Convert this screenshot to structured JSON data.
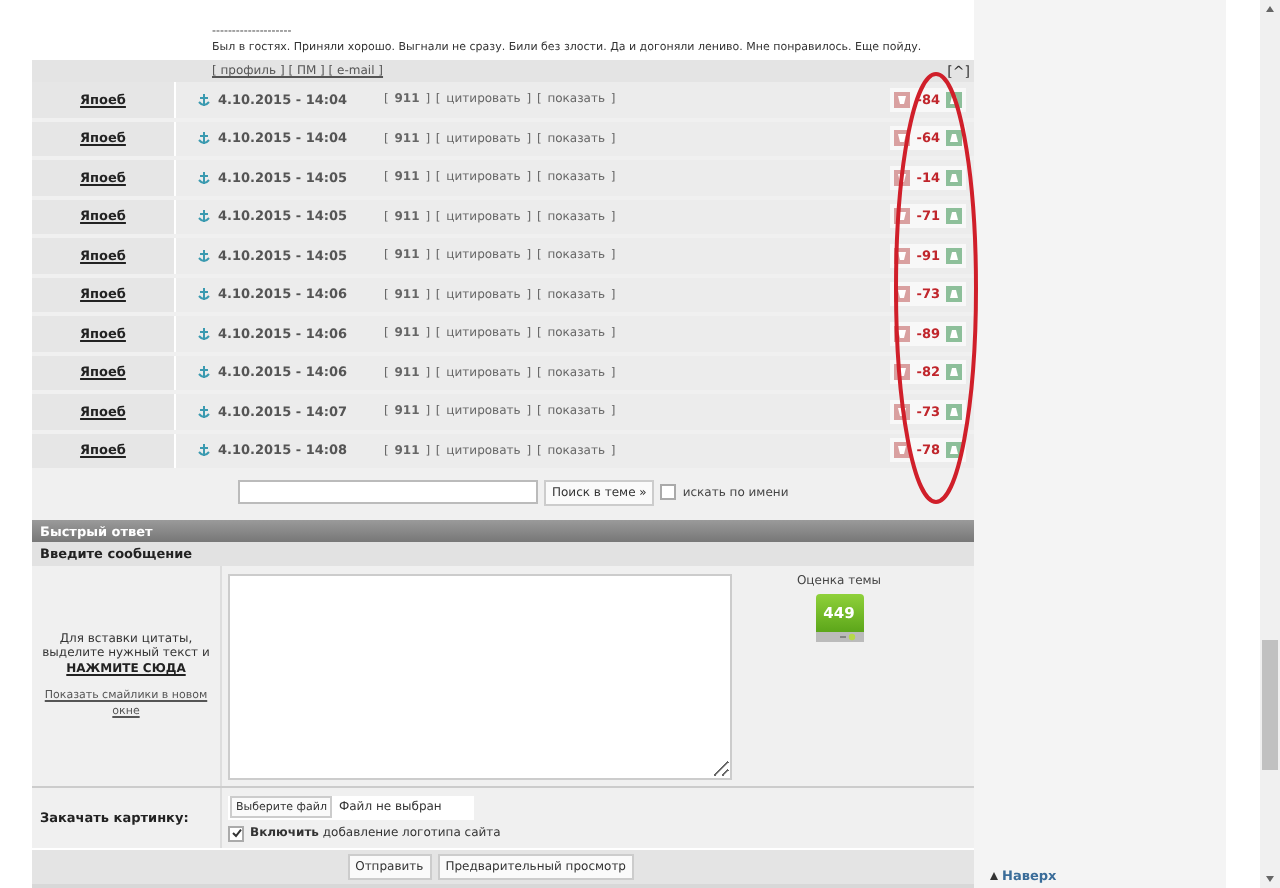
{
  "post": {
    "separator": "--------------------",
    "signature": "Был в гостях. Приняли хорошо. Выгнали не сразу. Били без злости. Да и догоняли лениво. Мне понравилось. Еще пойду.",
    "links": [
      "[ профиль ] [ ПМ ] [ e-mail ]"
    ],
    "top_link": "[^]"
  },
  "replies": [
    {
      "author": "Япоеб",
      "date": "4.10.2015 - 14:04",
      "actions": "[ **911** ] [ цитировать ] [ показать ]",
      "score": "-84"
    },
    {
      "author": "Япоеб",
      "date": "4.10.2015 - 14:04",
      "actions": "[ **911** ] [ цитировать ] [ показать ]",
      "score": "-64"
    },
    {
      "author": "Япоеб",
      "date": "4.10.2015 - 14:05",
      "actions": "[ **911** ] [ цитировать ] [ показать ]",
      "score": "-14"
    },
    {
      "author": "Япоеб",
      "date": "4.10.2015 - 14:05",
      "actions": "[ **911** ] [ цитировать ] [ показать ]",
      "score": "-71"
    },
    {
      "author": "Япоеб",
      "date": "4.10.2015 - 14:05",
      "actions": "[ **911** ] [ цитировать ] [ показать ]",
      "score": "-91"
    },
    {
      "author": "Япоеб",
      "date": "4.10.2015 - 14:06",
      "actions": "[ **911** ] [ цитировать ] [ показать ]",
      "score": "-73"
    },
    {
      "author": "Япоеб",
      "date": "4.10.2015 - 14:06",
      "actions": "[ **911** ] [ цитировать ] [ показать ]",
      "score": "-89"
    },
    {
      "author": "Япоеб",
      "date": "4.10.2015 - 14:06",
      "actions": "[ **911** ] [ цитировать ] [ показать ]",
      "score": "-82"
    },
    {
      "author": "Япоеб",
      "date": "4.10.2015 - 14:07",
      "actions": "[ **911** ] [ цитировать ] [ показать ]",
      "score": "-73"
    },
    {
      "author": "Япоеб",
      "date": "4.10.2015 - 14:08",
      "actions": "[ **911** ] [ цитировать ] [ показать ]",
      "score": "-78"
    }
  ],
  "search": {
    "button": "Поиск в теме »",
    "by_name": {
      "label": "искать по имени",
      "checked": false
    }
  },
  "quick_reply": {
    "title": "Быстрый ответ",
    "subtitle": "Введите сообщение",
    "hint": "Для вставки цитаты, выделите нужный текст и",
    "hint_link": "НАЖМИТЕ СЮДА",
    "smilies_link": "Показать смайлики в новом окне",
    "topic_rating_label": "Оценка темы",
    "topic_rating": "449",
    "upload_label": "Закачать картинку:",
    "file_button": "Выберите файл",
    "file_status": "Файл не выбран",
    "logo": {
      "label": "**Включить** добавление логотипа сайта",
      "checked": true
    },
    "buttons": [
      "Отправить",
      "Предварительный просмотр"
    ]
  },
  "sidebar": {
    "top_link": "Наверх"
  }
}
